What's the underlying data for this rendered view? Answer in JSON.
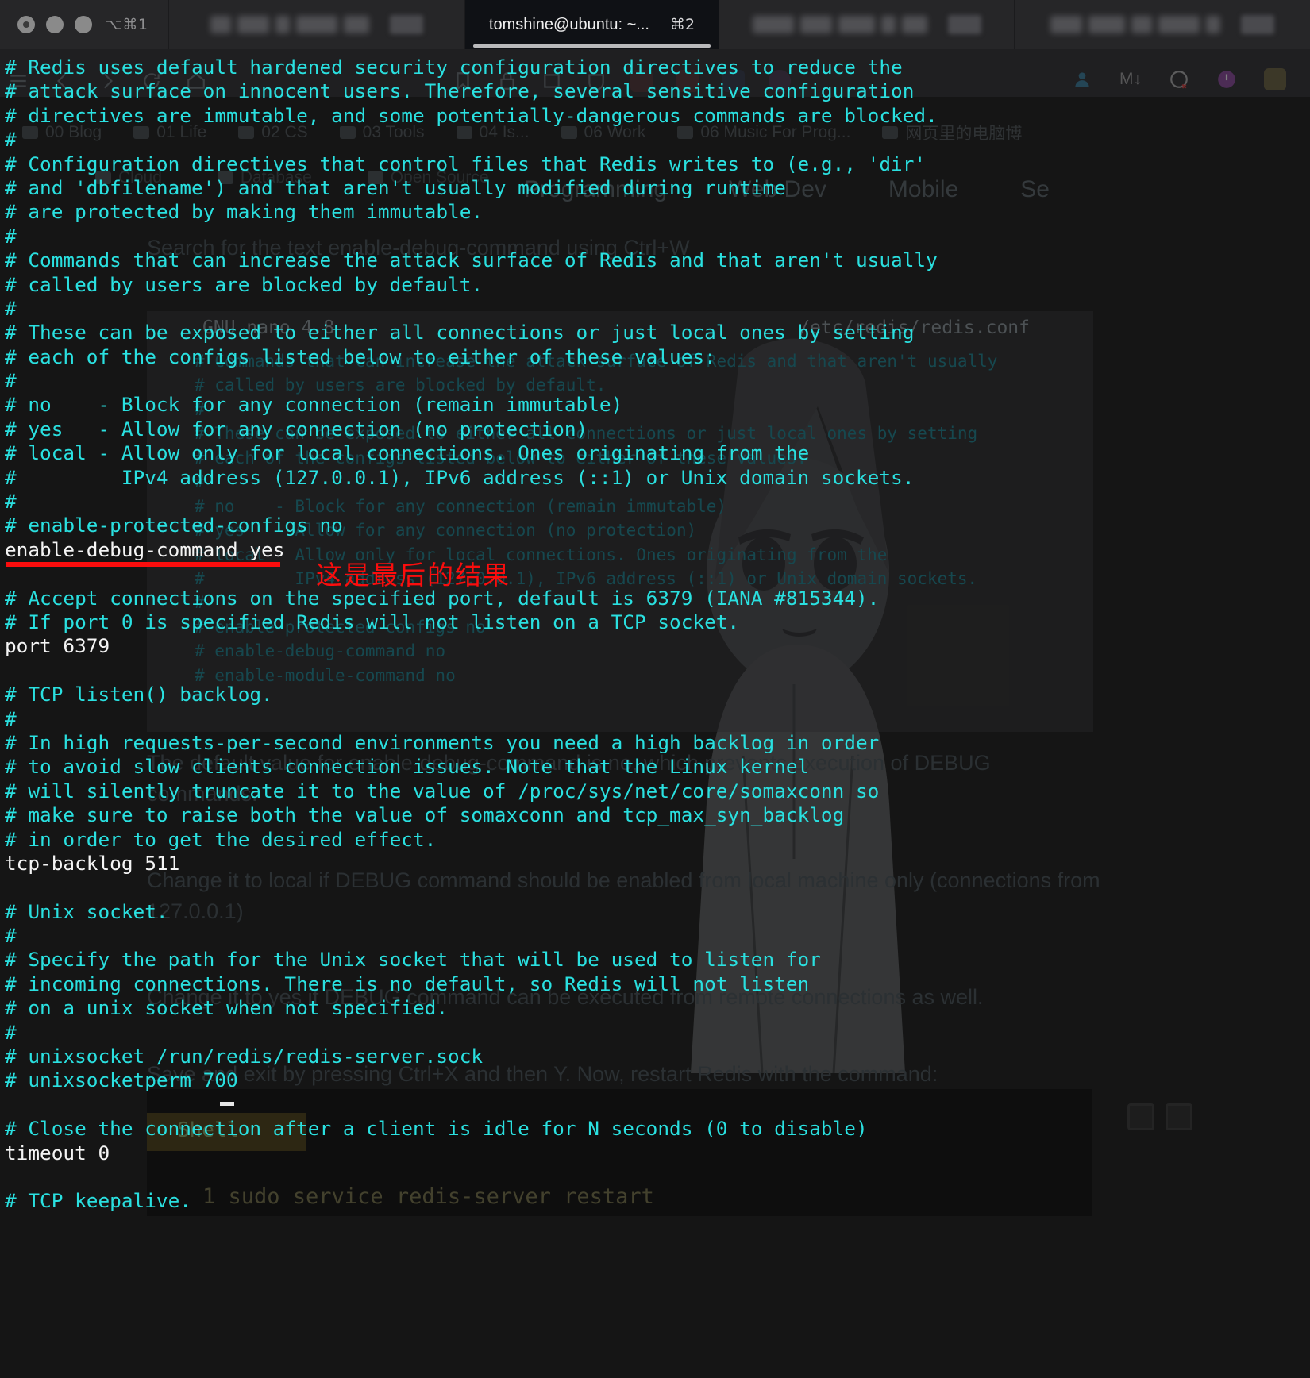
{
  "titlebar": {
    "window_controls": [
      "close",
      "minimize",
      "zoom"
    ],
    "shortcut_hint": "⌥⌘1",
    "tabs": [
      {
        "title": "",
        "shortcut": "",
        "active": false,
        "blurred": true
      },
      {
        "title": "tomshine@ubuntu: ~...",
        "shortcut": "⌘2",
        "active": true,
        "blurred": false
      },
      {
        "title": "",
        "shortcut": "",
        "active": false,
        "blurred": true
      },
      {
        "title": "",
        "shortcut": "",
        "active": false,
        "blurred": true
      }
    ]
  },
  "terminal": {
    "file": "/etc/redis/redis.conf",
    "editor": "GNU nano 4.8",
    "comment_color": "#2ae0e0",
    "value_color": "#f4f4f4",
    "lines": [
      {
        "t": "# Redis uses default hardened security configuration directives to reduce the",
        "k": "c"
      },
      {
        "t": "# attack surface on innocent users. Therefore, several sensitive configuration",
        "k": "c"
      },
      {
        "t": "# directives are immutable, and some potentially-dangerous commands are blocked.",
        "k": "c"
      },
      {
        "t": "#",
        "k": "c"
      },
      {
        "t": "# Configuration directives that control files that Redis writes to (e.g., 'dir'",
        "k": "c"
      },
      {
        "t": "# and 'dbfilename') and that aren't usually modified during runtime",
        "k": "c"
      },
      {
        "t": "# are protected by making them immutable.",
        "k": "c"
      },
      {
        "t": "#",
        "k": "c"
      },
      {
        "t": "# Commands that can increase the attack surface of Redis and that aren't usually",
        "k": "c"
      },
      {
        "t": "# called by users are blocked by default.",
        "k": "c"
      },
      {
        "t": "#",
        "k": "c"
      },
      {
        "t": "# These can be exposed to either all connections or just local ones by setting",
        "k": "c"
      },
      {
        "t": "# each of the configs listed below to either of these values:",
        "k": "c"
      },
      {
        "t": "#",
        "k": "c"
      },
      {
        "t": "# no    - Block for any connection (remain immutable)",
        "k": "c"
      },
      {
        "t": "# yes   - Allow for any connection (no protection)",
        "k": "c"
      },
      {
        "t": "# local - Allow only for local connections. Ones originating from the",
        "k": "c"
      },
      {
        "t": "#         IPv4 address (127.0.0.1), IPv6 address (::1) or Unix domain sockets.",
        "k": "c"
      },
      {
        "t": "#",
        "k": "c"
      },
      {
        "t": "# enable-protected-configs no",
        "k": "c"
      },
      {
        "t": "enable-debug-command yes",
        "k": "w"
      },
      {
        "t": "",
        "k": "c"
      },
      {
        "t": "# Accept connections on the specified port, default is 6379 (IANA #815344).",
        "k": "c"
      },
      {
        "t": "# If port 0 is specified Redis will not listen on a TCP socket.",
        "k": "c"
      },
      {
        "t": "port 6379",
        "k": "w"
      },
      {
        "t": "",
        "k": "c"
      },
      {
        "t": "# TCP listen() backlog.",
        "k": "c"
      },
      {
        "t": "#",
        "k": "c"
      },
      {
        "t": "# In high requests-per-second environments you need a high backlog in order",
        "k": "c"
      },
      {
        "t": "# to avoid slow clients connection issues. Note that the Linux kernel",
        "k": "c"
      },
      {
        "t": "# will silently truncate it to the value of /proc/sys/net/core/somaxconn so",
        "k": "c"
      },
      {
        "t": "# make sure to raise both the value of somaxconn and tcp_max_syn_backlog",
        "k": "c"
      },
      {
        "t": "# in order to get the desired effect.",
        "k": "c"
      },
      {
        "t": "tcp-backlog 511",
        "k": "w"
      },
      {
        "t": "",
        "k": "c"
      },
      {
        "t": "# Unix socket.",
        "k": "c"
      },
      {
        "t": "#",
        "k": "c"
      },
      {
        "t": "# Specify the path for the Unix socket that will be used to listen for",
        "k": "c"
      },
      {
        "t": "# incoming connections. There is no default, so Redis will not listen",
        "k": "c"
      },
      {
        "t": "# on a unix socket when not specified.",
        "k": "c"
      },
      {
        "t": "#",
        "k": "c"
      },
      {
        "t": "# unixsocket /run/redis/redis-server.sock",
        "k": "c"
      },
      {
        "t": "# unixsocketperm 700",
        "k": "c"
      },
      {
        "t": "",
        "k": "c"
      },
      {
        "t": "# Close the connection after a client is idle for N seconds (0 to disable)",
        "k": "c"
      },
      {
        "t": "timeout 0",
        "k": "w"
      },
      {
        "t": "",
        "k": "c"
      },
      {
        "t": "# TCP keepalive.",
        "k": "c"
      }
    ]
  },
  "annotation": {
    "note_text": "这是最后的结果",
    "note_color": "#fb0d0d",
    "underline_color": "#fb0d0d",
    "underlined_line": "enable-debug-command yes"
  },
  "background_page": {
    "bookmarks_row1": [
      "00 Blog",
      "01 Life",
      "02 CS",
      "03 Tools",
      "04 Is...",
      "06 Work",
      "06 Music For Prog...",
      "网页里的电脑博"
    ],
    "bookmarks_row2": [
      "Cloud",
      "Database",
      "Open Source"
    ],
    "nav_tabs": [
      "Programming",
      "Web Dev",
      "Mobile",
      "Se"
    ],
    "heading": "Search for the text enable-debug-command using Ctrl+W",
    "nano_header_left": "GNU nano 4.8",
    "nano_header_right": "/etc/redis/redis.conf",
    "nano_preview": "# Commands that can increase the attack surface of Redis and that aren't usually\n# called by users are blocked by default.\n#\n# These can be exposed to either all connections or just local ones by setting\n# each of the configs listed below to either of these values:\n#\n# no    - Block for any connection (remain immutable)\n# yes   - Allow for any connection (no protection)\n# local - Allow only for local connections. Ones originating from the\n#         IPv4 address (127.0.0.1), IPv6 address (::1) or Unix domain sockets.\n#\n# enable-protected-configs no\n# enable-debug-command no\n# enable-module-command no",
    "para1": "The default value for enable-debug-command is no, which prevents execution of DEBUG commands.",
    "para2": "Change it to local if DEBUG command should be enabled from local machine only (connections from 127.0.0.1)",
    "para3": "Change it to yes if DEBUG command can be executed from remote connections as well.",
    "para4": "Save and exit by pressing Ctrl+X and then Y. Now, restart Redis with the command:",
    "code_label": "Shell",
    "code_line": "1   sudo service redis-server restart",
    "code_buttons": [
      "stop-icon",
      "copy-icon"
    ]
  }
}
